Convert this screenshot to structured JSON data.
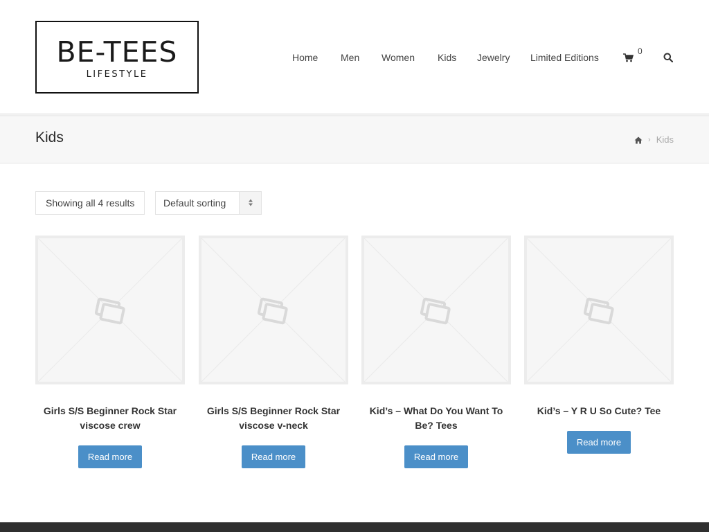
{
  "header": {
    "logo_main": "BE-TEES",
    "logo_sub": "LIFESTYLE",
    "nav": [
      {
        "label": "Home"
      },
      {
        "label": "Men"
      },
      {
        "label": "Women"
      },
      {
        "label": "Kids"
      },
      {
        "label": "Jewelry"
      },
      {
        "label": "Limited Editions"
      }
    ],
    "cart_count": "0",
    "cart_icon": "shopping-cart-icon",
    "search_icon": "search-icon"
  },
  "title_bar": {
    "title": "Kids",
    "breadcrumb": {
      "home_icon": "home-icon",
      "current": "Kids"
    }
  },
  "shop": {
    "result_count": "Showing all 4 results",
    "sorting": "Default sorting",
    "products": [
      {
        "title": "Girls S/S Beginner Rock Star viscose crew",
        "button": "Read more"
      },
      {
        "title": "Girls S/S Beginner Rock Star viscose v-neck",
        "button": "Read more"
      },
      {
        "title": "Kid’s – What Do You Want To Be? Tees",
        "button": "Read more"
      },
      {
        "title": "Kid’s – Y R U So Cute? Tee",
        "button": "Read more"
      }
    ]
  },
  "colors": {
    "accent": "#4b8fc8",
    "title_bar_bg": "#f7f7f7",
    "footer_bg": "#2f2f2f"
  }
}
